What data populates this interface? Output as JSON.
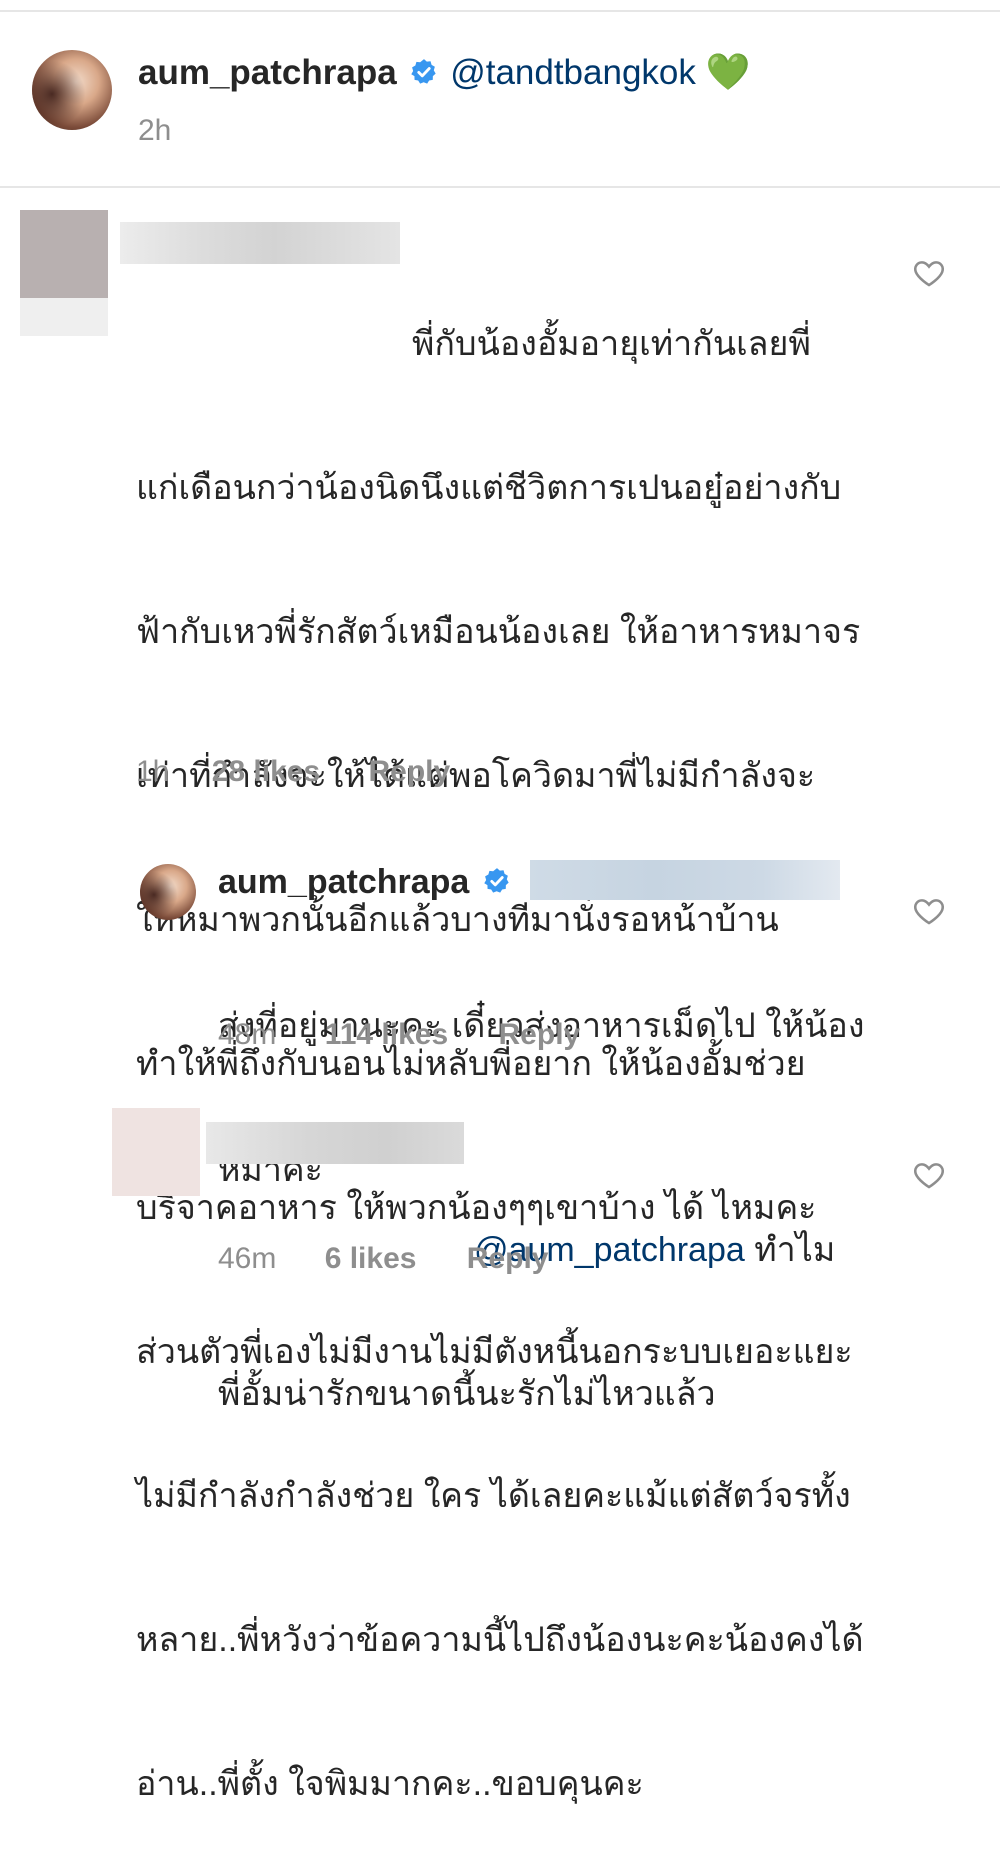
{
  "post": {
    "username": "aum_patchrapa",
    "caption_mention": "@tandtbangkok",
    "caption_emoji": "💚",
    "time": "2h"
  },
  "comments": [
    {
      "lines": [
        "พี่กับน้องอั้มอายุเท่ากันเลยพี่",
        "แก่เดือนกว่าน้องนิดนึงแต่ชีวิตการเปนอยู๋อย่างกับ",
        "ฟ้ากับเหวพี่รักสัตว์เหมือนน้องเลย ให้อาหารหมาจร",
        "เท่าที่กำลังจะให้ได้แต่พอโควิดมาพี่ไม่มีกำลังจะ",
        "ให้หมาพวกนั้นอีกแล้วบางทีมานั่งรอหน้าบ้าน",
        "ทำให้พี่ถึงกับนอนไม่หลับพี่อยาก ให้น้องอั้มช่วย",
        "บริจาคอาหาร ให้พวกน้องๆๆเขาบ้าง ได้ ไหมคะ",
        "ส่วนตัวพี่เองไม่มีงานไม่มีตังหนี้นอกระบบเยอะแยะ",
        "ไม่มีกำลังกำลังช่วย ใคร ได้เลยคะแม้แต่สัตว์จรทั้ง",
        "หลาย..พี่หวังว่าข้อความนี้ไปถึงน้องนะคะน้องคงได้",
        "อ่าน..พี่ตั้ง ใจพิมมากคะ..ขอบคุนคะ"
      ],
      "time": "1h",
      "likes": "28 likes",
      "reply": "Reply"
    },
    {
      "username": "aum_patchrapa",
      "lines": [
        "ส่งที่อยู่มานะคะ เดี๋ยวส่งอาหารเม็ดไป ให้น้อง",
        "หมาค่ะ"
      ],
      "time": "48m",
      "likes": "114 likes",
      "reply": "Reply"
    },
    {
      "mention": "@aum_patchrapa",
      "first_line_rest": " ทำไม",
      "lines": [
        "พี่อั้มน่ารักขนาดนี้นะรักไม่ไหวแล้ว"
      ],
      "time": "46m",
      "likes": "6 likes",
      "reply": "Reply"
    }
  ],
  "colors": {
    "text": "#262626",
    "muted": "#8e8e8e",
    "mention": "#00376b",
    "verified": "#3897f0"
  }
}
